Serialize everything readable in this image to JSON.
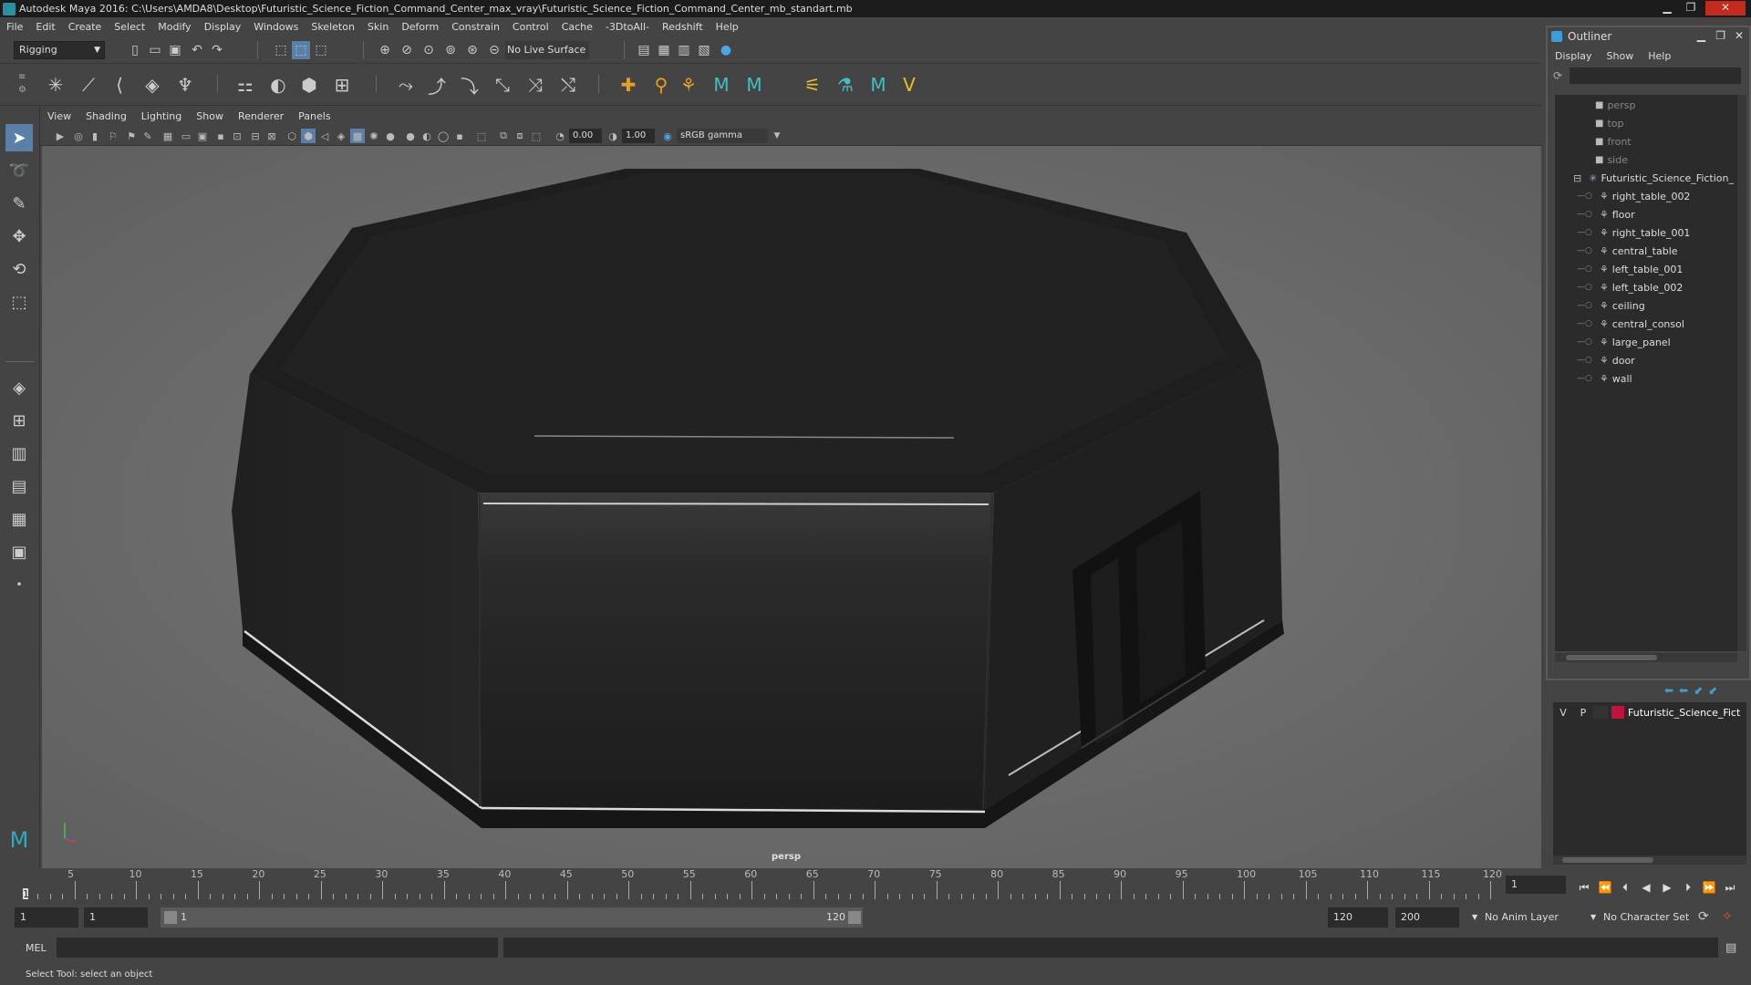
{
  "window": {
    "title": "Autodesk Maya 2016: C:\\Users\\AMDA8\\Desktop\\Futuristic_Science_Fiction_Command_Center_max_vray\\Futuristic_Science_Fiction_Command_Center_mb_standart.mb",
    "minimize": "▁",
    "maximize": "❐",
    "close": "✕"
  },
  "menubar": [
    "File",
    "Edit",
    "Create",
    "Select",
    "Modify",
    "Display",
    "Windows",
    "Skeleton",
    "Skin",
    "Deform",
    "Constrain",
    "Control",
    "Cache",
    "-3DtoAll-",
    "Redshift",
    "Help"
  ],
  "statusline": {
    "menuset": "Rigging",
    "live_surface": "No Live Surface"
  },
  "viewport": {
    "menu": [
      "View",
      "Shading",
      "Lighting",
      "Show",
      "Renderer",
      "Panels"
    ],
    "exposure": "0.00",
    "gamma": "1.00",
    "colorspace": "sRGB gamma",
    "camera_label": "persp"
  },
  "outliner": {
    "title": "Outliner",
    "menu": [
      "Display",
      "Show",
      "Help"
    ],
    "cameras": [
      "persp",
      "top",
      "front",
      "side"
    ],
    "root": "Futuristic_Science_Fiction_",
    "children": [
      "right_table_002",
      "floor",
      "right_table_001",
      "central_table",
      "left_table_001",
      "left_table_002",
      "ceiling",
      "central_consol",
      "large_panel",
      "door",
      "wall"
    ]
  },
  "layers": {
    "v": "V",
    "p": "P",
    "name": "Futuristic_Science_Fict",
    "color": "#c0143c"
  },
  "timeline": {
    "ticks": [
      "5",
      "10",
      "15",
      "20",
      "25",
      "30",
      "35",
      "40",
      "45",
      "50",
      "55",
      "60",
      "65",
      "70",
      "75",
      "80",
      "85",
      "90",
      "95",
      "100",
      "105",
      "110",
      "115",
      "120"
    ],
    "current_frame": "1",
    "frame_marker": "1"
  },
  "range": {
    "start": "1",
    "playback_start": "1",
    "slider_start": "1",
    "slider_end": "120",
    "playback_end": "120",
    "end": "200",
    "anim_layer": "No Anim Layer",
    "character_set": "No Character Set"
  },
  "cmdline": {
    "label": "MEL"
  },
  "helpline": "Select Tool: select an object"
}
